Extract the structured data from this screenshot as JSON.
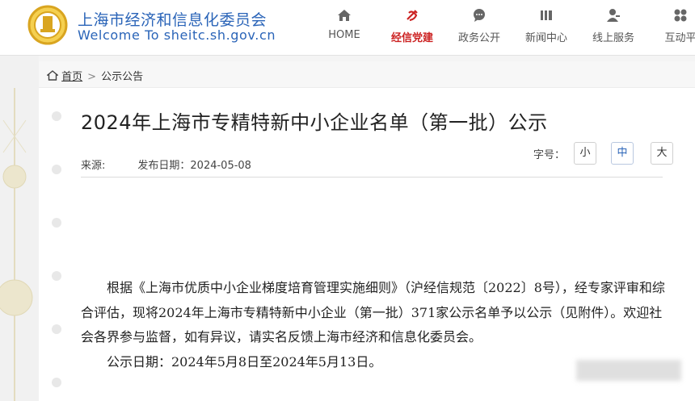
{
  "site": {
    "name_cn": "上海市经济和信息化委员会",
    "name_en": "Welcome To sheitc.sh.gov.cn"
  },
  "nav": [
    {
      "label": "HOME",
      "icon": "home-icon",
      "active": false
    },
    {
      "label": "经信党建",
      "icon": "party-emblem-icon",
      "active": true
    },
    {
      "label": "政务公开",
      "icon": "chat-icon",
      "active": false
    },
    {
      "label": "新闻中心",
      "icon": "news-icon",
      "active": false
    },
    {
      "label": "线上服务",
      "icon": "user-icon",
      "active": false
    },
    {
      "label": "互动平",
      "icon": "interaction-icon",
      "active": false
    }
  ],
  "breadcrumb": {
    "home": "首页",
    "separator": ">",
    "current": "公示公告"
  },
  "article": {
    "title": "2024年上海市专精特新中小企业名单（第一批）公示",
    "source_label": "来源:",
    "date_label": "发布日期：",
    "date": "2024-05-08",
    "font_size_label": "字号：",
    "font_sizes": [
      "小",
      "中",
      "大"
    ],
    "paragraphs": [
      "根据《上海市优质中小企业梯度培育管理实施细则》（沪经信规范〔2022〕8号），经专家评审和综合评估，现将2024年上海市专精特新中小企业（第一批）371家公示名单予以公示（见附件）。欢迎社会各界参与监督，如有异议，请实名反馈上海市经济和信息化委员会。",
      "公示日期：2024年5月8日至2024年5月13日。"
    ]
  },
  "colors": {
    "brand_blue": "#2a64b8",
    "party_red": "#cc2222",
    "logo_gold": "#d9a520"
  }
}
